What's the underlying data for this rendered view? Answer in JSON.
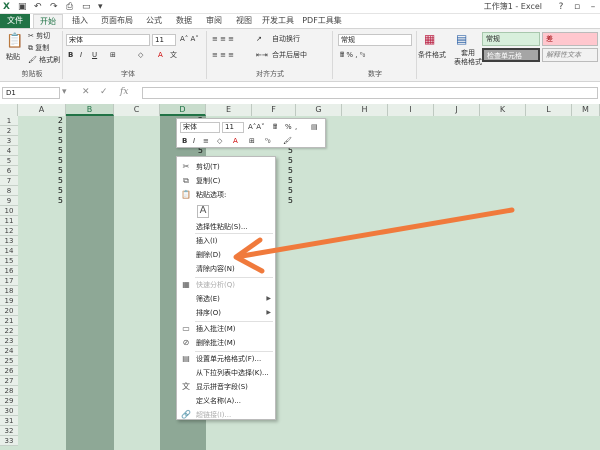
{
  "window": {
    "title": "工作簿1 - Excel",
    "qa_icons": [
      "excel-logo-icon",
      "save-icon",
      "undo-icon",
      "redo-icon",
      "print-preview-icon",
      "open-icon",
      "customize-icon"
    ]
  },
  "tabs": [
    "文件",
    "开始",
    "插入",
    "页面布局",
    "公式",
    "数据",
    "审阅",
    "视图",
    "开发工具",
    "PDF工具集"
  ],
  "ribbon": {
    "clipboard": {
      "paste": "粘贴",
      "cut": "剪切",
      "copy": "复制",
      "format_painter": "格式刷",
      "group": "剪贴板"
    },
    "font": {
      "font_name": "宋体",
      "font_size": "11",
      "group": "字体"
    },
    "alignment": {
      "wrap": "自动换行",
      "merge": "合并后居中",
      "group": "对齐方式"
    },
    "number": {
      "format": "常规",
      "group": "数字"
    },
    "styles": {
      "conditional": "条件格式",
      "table": "套用\n表格格式",
      "normal": "常规",
      "bad": "差",
      "check": "检查单元格",
      "explanatory": "解释性文本"
    }
  },
  "formula_bar": {
    "name_box": "D1",
    "fx": "fx"
  },
  "columns": [
    "A",
    "B",
    "C",
    "D",
    "E",
    "F",
    "G",
    "H",
    "I",
    "J",
    "K",
    "L",
    "M"
  ],
  "rows": [
    "1",
    "2",
    "3",
    "4",
    "5",
    "6",
    "7",
    "8",
    "9",
    "10",
    "11",
    "12",
    "13",
    "14",
    "15",
    "16",
    "17",
    "18",
    "19",
    "20",
    "21",
    "22",
    "23",
    "24",
    "25",
    "26",
    "27",
    "28",
    "29",
    "30",
    "31",
    "32",
    "33"
  ],
  "cells": {
    "A": [
      "2",
      "5",
      "5",
      "5",
      "5",
      "5",
      "5",
      "5",
      "5"
    ],
    "D": [
      "2",
      "5",
      "5",
      "5",
      "5",
      "5",
      "5",
      "5",
      "5"
    ],
    "F": [
      "",
      "",
      "",
      "5",
      "5",
      "5",
      "5",
      "5",
      "5"
    ]
  },
  "mini_toolbar": {
    "font": "宋体",
    "size": "11",
    "percent": "%"
  },
  "context_menu": [
    {
      "label": "剪切(T)",
      "icon": "scissors-icon",
      "disabled": false
    },
    {
      "label": "复制(C)",
      "icon": "copy-icon",
      "disabled": false
    },
    {
      "label": "粘贴选项:",
      "icon": "paste-icon",
      "disabled": false
    },
    {
      "label": "",
      "icon": "paste-option-icon",
      "disabled": false
    },
    {
      "label": "选择性粘贴(S)...",
      "icon": "",
      "disabled": false
    },
    {
      "label": "插入(I)",
      "icon": "",
      "disabled": false
    },
    {
      "label": "删除(D)",
      "icon": "",
      "disabled": false
    },
    {
      "label": "清除内容(N)",
      "icon": "",
      "disabled": false
    },
    {
      "label": "快速分析(Q)",
      "icon": "quick-analysis-icon",
      "disabled": true
    },
    {
      "label": "筛选(E)",
      "icon": "",
      "disabled": false,
      "submenu": true
    },
    {
      "label": "排序(O)",
      "icon": "",
      "disabled": false,
      "submenu": true
    },
    {
      "label": "插入批注(M)",
      "icon": "insert-comment-icon",
      "disabled": false
    },
    {
      "label": "删除批注(M)",
      "icon": "delete-comment-icon",
      "disabled": false
    },
    {
      "label": "设置单元格格式(F)...",
      "icon": "format-cells-icon",
      "disabled": false
    },
    {
      "label": "从下拉列表中选择(K)...",
      "icon": "",
      "disabled": false
    },
    {
      "label": "显示拼音字段(S)",
      "icon": "phonetic-icon",
      "disabled": false
    },
    {
      "label": "定义名称(A)...",
      "icon": "",
      "disabled": false
    },
    {
      "label": "超链接(I)...",
      "icon": "hyperlink-icon",
      "disabled": true
    }
  ],
  "colors": {
    "accent": "#217346",
    "annotation_arrow": "#f07a3c"
  }
}
